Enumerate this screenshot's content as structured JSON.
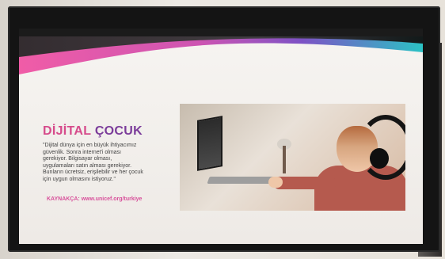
{
  "slide": {
    "title_part1": "DİJİTAL",
    "title_part2": "ÇOCUK",
    "quote": "\"Dijital dünya için en büyük ihtiyacımız\ngüvenlik. Sonra internet'i olması\ngerekiyor. Bilgisayar olması,\nuygulamaları satın alması gerekiyor.\nBunların ücretsiz, erişilebilir ve her çocuk\niçin uygun olmasını istiyoruz.\"",
    "source": "KAYNAKÇA: www.unicef.org/turkiye"
  },
  "colors": {
    "accent_pink": "#d64b8b",
    "accent_purple": "#7b3c9a",
    "source_pink": "#d8509b"
  }
}
